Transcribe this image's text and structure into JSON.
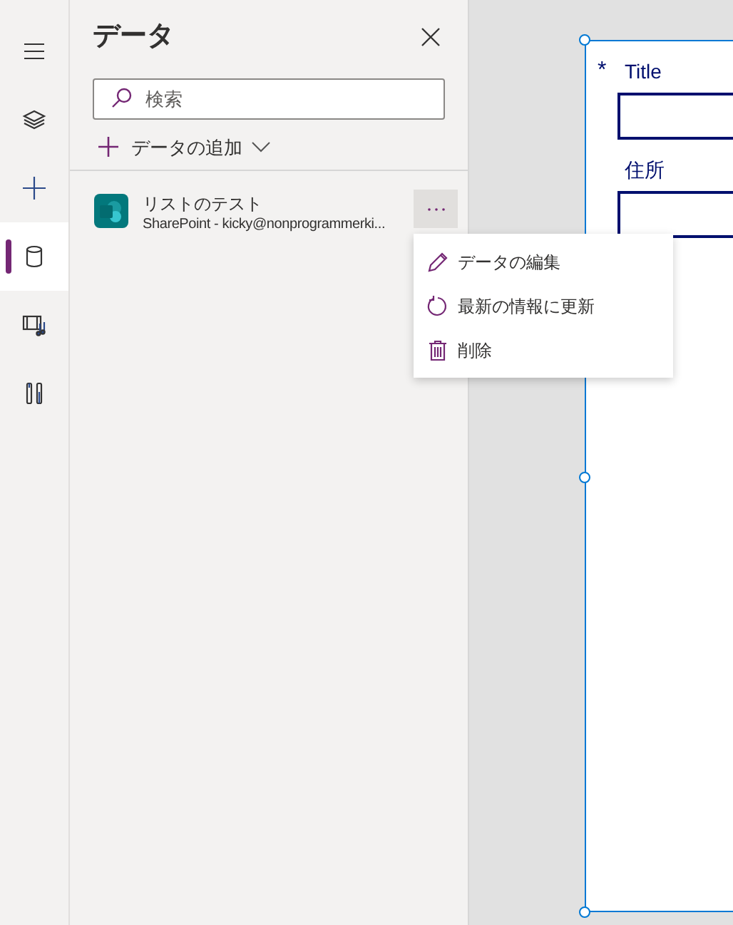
{
  "rail": [
    {
      "kind": "menu",
      "selected": false
    },
    {
      "kind": "layers",
      "selected": false
    },
    {
      "kind": "insert",
      "selected": false
    },
    {
      "kind": "data",
      "selected": true
    },
    {
      "kind": "media",
      "selected": false
    },
    {
      "kind": "tools",
      "selected": false
    }
  ],
  "panel": {
    "title": "データ",
    "search": {
      "placeholder": "検索"
    },
    "add_data": "データの追加",
    "sources": [
      {
        "name": "リストのテスト",
        "detail": "SharePoint - kicky@nonprogrammerki..."
      }
    ]
  },
  "context_menu": [
    {
      "kind": "edit",
      "label": "データの編集"
    },
    {
      "kind": "refresh",
      "label": "最新の情報に更新"
    },
    {
      "kind": "delete",
      "label": "削除"
    }
  ],
  "form": {
    "fields": [
      {
        "marker": "*",
        "label": "Title"
      },
      {
        "label": "住所"
      }
    ]
  }
}
